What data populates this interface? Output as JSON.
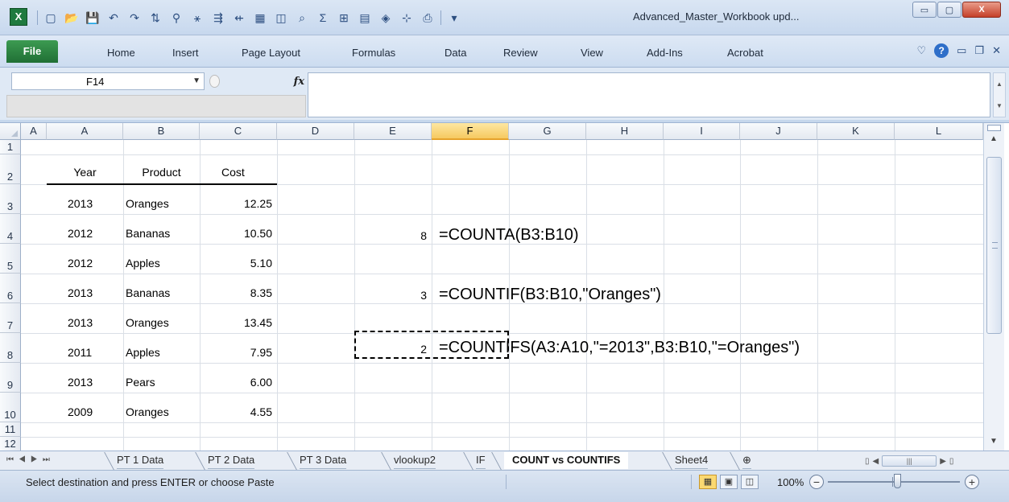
{
  "window": {
    "title": "Advanced_Master_Workbook upd...",
    "app_icon": "X",
    "qat_icons": [
      "new-icon",
      "open-icon",
      "save-icon",
      "undo-icon",
      "redo-icon",
      "sort-ascending-icon",
      "filter-icon",
      "clear-filter-icon",
      "insert-row-icon",
      "delete-row-icon",
      "table-icon",
      "print-preview-icon",
      "sum-icon",
      "borders-icon",
      "format-icon",
      "shapes-icon",
      "freeze-icon",
      "print-icon",
      "customize-qat-icon"
    ],
    "controls": {
      "minimize": "▭",
      "maximize": "▢",
      "close": "X"
    }
  },
  "ribbon": {
    "file_tab": "File",
    "tabs": [
      "Home",
      "Insert",
      "Page Layout",
      "Formulas",
      "Data",
      "Review",
      "View",
      "Add-Ins",
      "Acrobat"
    ],
    "help_icon": "?"
  },
  "formula_bar": {
    "name_box": "F14",
    "fx_label": "fx",
    "formula": ""
  },
  "grid": {
    "columns": [
      "A",
      "B",
      "C",
      "D",
      "E",
      "F",
      "G",
      "H",
      "I",
      "J",
      "K",
      "L"
    ],
    "selected_column": "F",
    "rows": [
      "1",
      "2",
      "3",
      "4",
      "5",
      "6",
      "7",
      "8",
      "9",
      "10",
      "11",
      "12"
    ],
    "table_headers": [
      "Year",
      "Product",
      "Cost"
    ],
    "table_rows": [
      [
        "2013",
        "Oranges",
        "12.25"
      ],
      [
        "2012",
        "Bananas",
        "10.50"
      ],
      [
        "2012",
        "Apples",
        "5.10"
      ],
      [
        "2013",
        "Bananas",
        "8.35"
      ],
      [
        "2013",
        "Oranges",
        "13.45"
      ],
      [
        "2011",
        "Apples",
        "7.95"
      ],
      [
        "2013",
        "Pears",
        "6.00"
      ],
      [
        "2009",
        "Oranges",
        "4.55"
      ]
    ],
    "results": [
      {
        "row": "4",
        "value": "8",
        "formula": "=COUNTA(B3:B10)"
      },
      {
        "row": "6",
        "value": "3",
        "formula": "=COUNTIF(B3:B10,\"Oranges\")"
      },
      {
        "row": "8",
        "value": "2",
        "formula": "=COUNTIFS(A3:A10,\"=2013\",B3:B10,\"=Oranges\")"
      }
    ]
  },
  "sheets": {
    "tabs": [
      "PT 1 Data",
      "PT 2 Data",
      "PT 3 Data",
      "vlookup2",
      "IF",
      "COUNT vs COUNTIFS",
      "Sheet4"
    ],
    "active": "COUNT vs COUNTIFS"
  },
  "status_bar": {
    "message": "Select destination and press ENTER or choose Paste",
    "zoom": "100%"
  }
}
